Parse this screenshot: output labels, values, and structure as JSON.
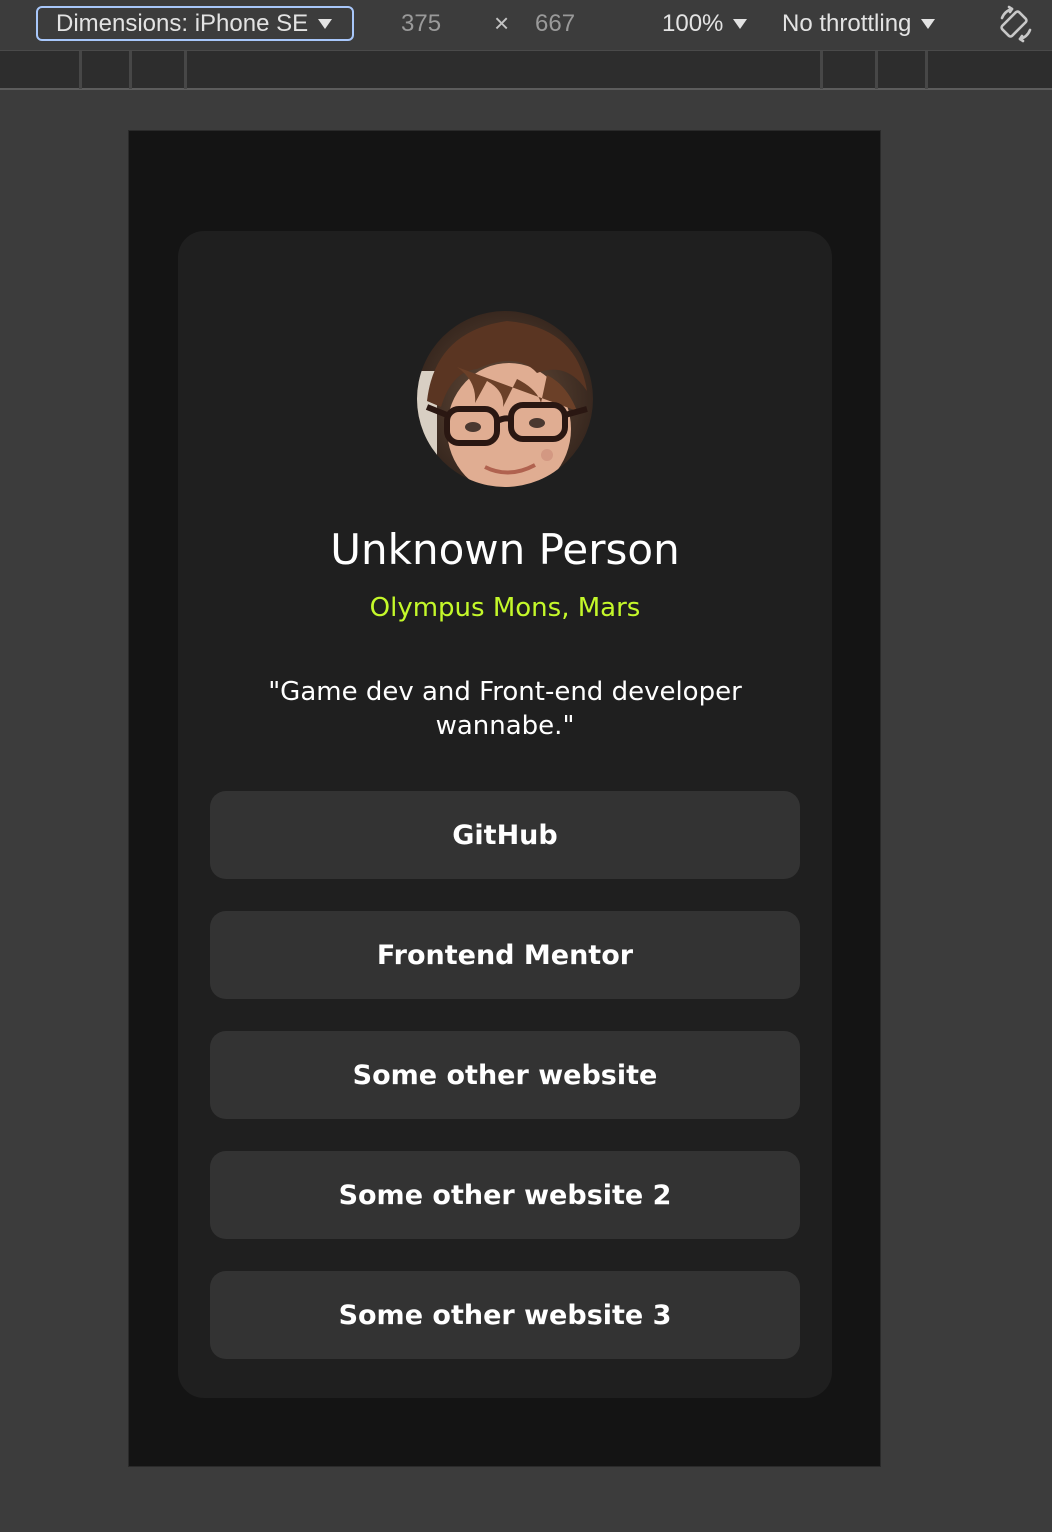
{
  "devtools": {
    "device_label": "Dimensions: iPhone SE",
    "width": "375",
    "times": "×",
    "height": "667",
    "zoom": "100%",
    "throttling": "No throttling",
    "rotate_icon": "rotate-icon"
  },
  "profile": {
    "name": "Unknown Person",
    "location": "Olympus Mons, Mars",
    "bio": "\"Game dev and Front-end developer wannabe.\"",
    "location_color": "#c4f82a",
    "links": [
      {
        "label": "GitHub"
      },
      {
        "label": "Frontend Mentor"
      },
      {
        "label": "Some other website"
      },
      {
        "label": "Some other website 2"
      },
      {
        "label": "Some other website 3"
      }
    ]
  }
}
